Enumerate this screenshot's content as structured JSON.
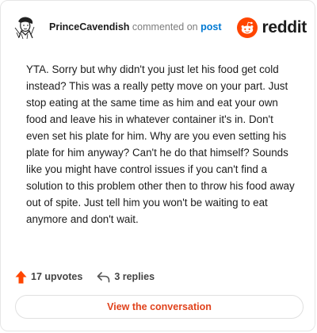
{
  "header": {
    "username": "PrinceCavendish",
    "action": "commented on",
    "post_link": "post",
    "brand": "reddit",
    "brand_color": "#ff4500",
    "link_color": "#0079d3"
  },
  "comment": {
    "body": "YTA. Sorry but why didn't you just let his food get cold instead? This was a really petty move on your part. Just stop eating at the same time as him and eat your own food and leave his in whatever container it's in. Don't even set his plate for him. Why are you even setting his plate for him anyway? Can't he do that himself? Sounds like you might have control issues if you can't find a solution to this problem other then to throw his food away out of spite. Just tell him you won't be waiting to eat anymore and don't wait."
  },
  "footer": {
    "upvotes": "17 upvotes",
    "upvote_icon": "upvote-arrow-icon",
    "replies": "3 replies",
    "reply_icon": "reply-arrow-icon",
    "upvote_color": "#ff4500"
  },
  "cta": {
    "label": "View the conversation",
    "color": "#e0421c"
  }
}
